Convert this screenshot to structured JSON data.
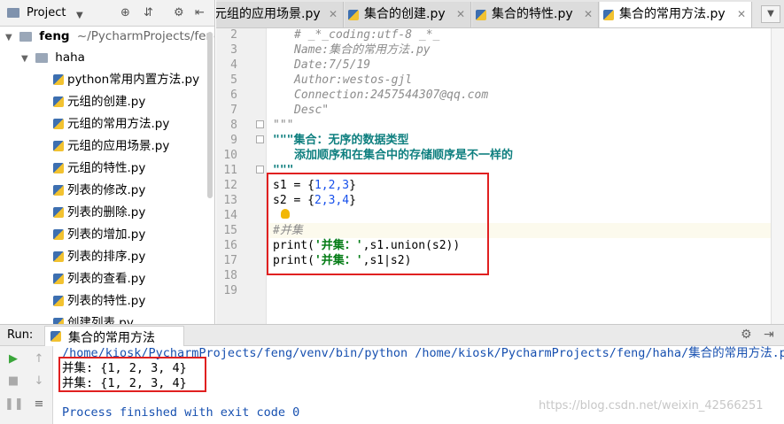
{
  "project": {
    "title": "Project",
    "root_name": "feng",
    "root_path": "~/PycharmProjects/feng",
    "subfolder": "haha",
    "files": [
      "python常用内置方法.py",
      "元组的创建.py",
      "元组的常用方法.py",
      "元组的应用场景.py",
      "元组的特性.py",
      "列表的修改.py",
      "列表的删除.py",
      "列表的增加.py",
      "列表的排序.py",
      "列表的查看.py",
      "列表的特性.py",
      "创建列表.py"
    ]
  },
  "tabs": [
    {
      "label": "元组的应用场景.py",
      "active": false
    },
    {
      "label": "集合的创建.py",
      "active": false
    },
    {
      "label": "集合的特性.py",
      "active": false
    },
    {
      "label": "集合的常用方法.py",
      "active": true
    }
  ],
  "editor": {
    "line_numbers": [
      "2",
      "3",
      "4",
      "5",
      "6",
      "7",
      "8",
      "9",
      "10",
      "11",
      "12",
      "13",
      "14",
      "15",
      "16",
      "17",
      "18",
      "19"
    ],
    "lines": {
      "l2": "# _*_coding:utf-8 _*_",
      "l3": "Name:集合的常用方法.py",
      "l4": "Date:7/5/19",
      "l5": "Author:westos-gjl",
      "l6": "Connection:2457544307@qq.com",
      "l7": "Desc\"",
      "l8": "\"\"\"",
      "l9": "\"\"\"集合：无序的数据类型",
      "l10": "添加顺序和在集合中的存储顺序是不一样的",
      "l11": "\"\"\"",
      "l12_a": "s1 = {",
      "l12_n": "1,2,3",
      "l12_b": "}",
      "l13_a": "s2 = {",
      "l13_n": "2,3,4",
      "l13_b": "}",
      "l15": "#并集",
      "l16_a": "print(",
      "l16_s": "'并集：'",
      "l16_b": ",s1.union(s2))",
      "l17_a": "print(",
      "l17_s": "'并集：'",
      "l17_b": ",s1|s2)"
    }
  },
  "run": {
    "label": "Run:",
    "tab_label": "集合的常用方法",
    "command": "/home/kiosk/PycharmProjects/feng/venv/bin/python /home/kiosk/PycharmProjects/feng/haha/集合的常用方法.py",
    "output": [
      "并集: {1, 2, 3, 4}",
      "并集: {1, 2, 3, 4}"
    ],
    "exit": "Process finished with exit code 0"
  },
  "watermark": "https://blog.csdn.net/weixin_42566251",
  "colors": {
    "highlight_box": "#e02020",
    "docstring": "#0e7f7f",
    "string": "#067d17",
    "number": "#1750eb",
    "console_info": "#1750b0"
  }
}
